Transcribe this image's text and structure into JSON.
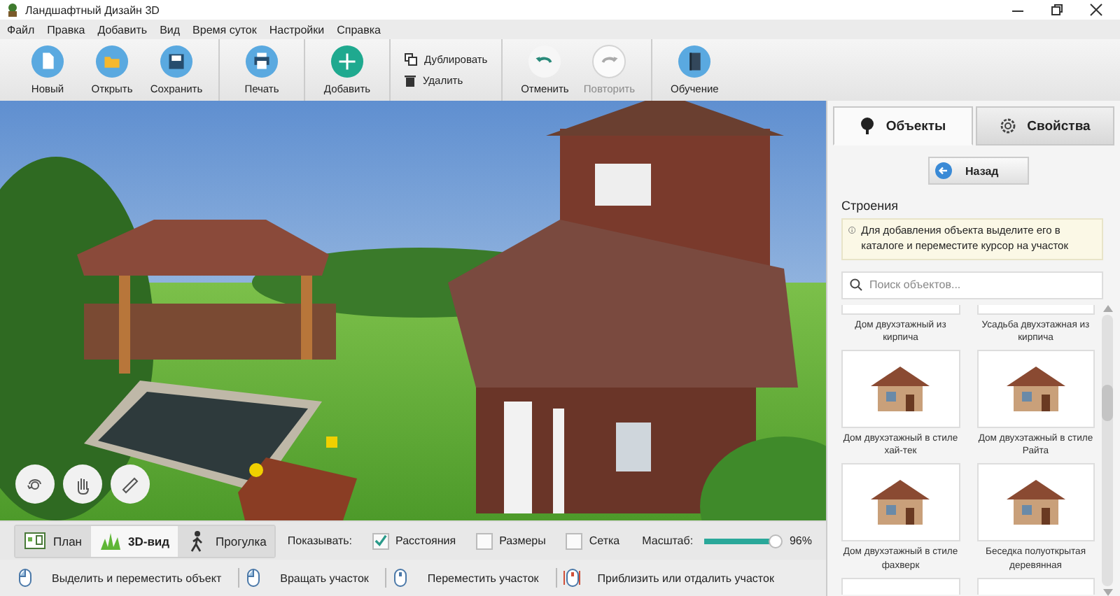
{
  "window": {
    "title": "Ландшафтный Дизайн 3D"
  },
  "menu": [
    "Файл",
    "Правка",
    "Добавить",
    "Вид",
    "Время суток",
    "Настройки",
    "Справка"
  ],
  "toolbar": [
    [
      {
        "kind": "new",
        "label": "Новый",
        "disabled": false
      },
      {
        "kind": "open",
        "label": "Открыть",
        "disabled": false
      },
      {
        "kind": "save",
        "label": "Сохранить",
        "disabled": false
      }
    ],
    [
      {
        "kind": "print",
        "label": "Печать",
        "disabled": false
      }
    ],
    [
      {
        "kind": "add",
        "label": "Добавить",
        "disabled": false
      }
    ],
    [
      {
        "kind": "duplicate",
        "label": "Дублировать",
        "disabled": false
      },
      {
        "kind": "delete",
        "label": "Удалить",
        "disabled": false
      }
    ],
    [
      {
        "kind": "undo",
        "label": "Отменить",
        "disabled": false
      },
      {
        "kind": "redo",
        "label": "Повторить",
        "disabled": true
      }
    ],
    [
      {
        "kind": "tutorial",
        "label": "Обучение",
        "disabled": false
      }
    ]
  ],
  "viewport_tools": [
    {
      "kind": "rotate"
    },
    {
      "kind": "hand"
    },
    {
      "kind": "ruler"
    }
  ],
  "view_tabs": [
    {
      "kind": "plan",
      "label": "План",
      "selected": false
    },
    {
      "kind": "perspective",
      "label": "3D-вид",
      "selected": true
    },
    {
      "kind": "walk",
      "label": "Прогулка",
      "selected": false
    }
  ],
  "show": {
    "label": "Показывать:",
    "options": [
      {
        "label": "Расстояния",
        "checked": true
      },
      {
        "label": "Размеры",
        "checked": false
      },
      {
        "label": "Сетка",
        "checked": false
      }
    ]
  },
  "zoom": {
    "label": "Масштаб:",
    "level": 0.96,
    "reading": "96%"
  },
  "status_hints": [
    {
      "kind": "left",
      "text": "Выделить и переместить объект"
    },
    {
      "kind": "left",
      "text": "Вращать участок"
    },
    {
      "kind": "middle",
      "text": "Переместить участок"
    },
    {
      "kind": "wheel",
      "text": "Приблизить или отдалить участок"
    }
  ],
  "panel": {
    "tabs": [
      {
        "kind": "objects",
        "label": "Объекты",
        "selected": true
      },
      {
        "kind": "properties",
        "label": "Свойства",
        "selected": false
      }
    ],
    "back_button": "Назад",
    "section": "Строения",
    "info": "Для добавления объекта выделите его в каталоге и переместите курсор на участок",
    "search": {
      "placeholder": "Поиск объектов..."
    },
    "items": [
      {
        "kind": "cut-top",
        "name": "Дом двухэтажный из кирпича"
      },
      {
        "kind": "cut-top",
        "name": "Усадьба двухэтажная из кирпича"
      },
      {
        "kind": "full",
        "name": "Дом двухэтажный в стиле хай-тек"
      },
      {
        "kind": "full",
        "name": "Дом двухэтажный в стиле Райта"
      },
      {
        "kind": "full",
        "name": "Дом двухэтажный в стиле фахверк"
      },
      {
        "kind": "full",
        "name": "Беседка полуоткрытая деревянная"
      },
      {
        "kind": "cut-bottom"
      },
      {
        "kind": "cut-bottom"
      }
    ]
  }
}
